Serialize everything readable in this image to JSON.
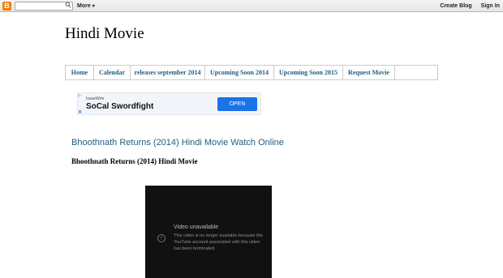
{
  "navbar": {
    "logo": "B",
    "search_icon": "search-icon",
    "more_label": "More",
    "more_caret": "▾",
    "create_blog": "Create Blog",
    "sign_in": "Sign In"
  },
  "blog": {
    "title": "Hindi Movie"
  },
  "tabs": [
    {
      "label": "Home"
    },
    {
      "label": "Calendar"
    },
    {
      "label": "releases september 2014"
    },
    {
      "label": "Upcoming Soon 2014"
    },
    {
      "label": "Upcoming Soon 2015"
    },
    {
      "label": "Request Movie"
    }
  ],
  "ad": {
    "brand": "IssueWire",
    "headline": "SoCal Swordfight",
    "cta": "OPEN",
    "close": "✕"
  },
  "post": {
    "title": "Bhoothnath Returns (2014) Hindi Movie Watch Online",
    "subtitle": "Bhoothnath Returns (2014) Hindi Movie"
  },
  "video": {
    "heading": "Video unavailable",
    "message": "This video is no longer available because the YouTube account associated with this video has been terminated.",
    "icon_glyph": "!"
  },
  "colors": {
    "link": "#215e80",
    "ad_button": "#1a73e8",
    "blogger_orange": "#f57d00"
  }
}
